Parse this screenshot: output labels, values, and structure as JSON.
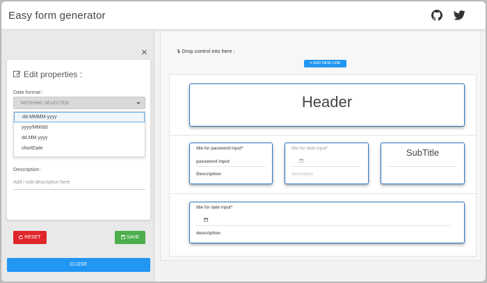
{
  "app": {
    "title": "Easy form generator"
  },
  "icons": {
    "github": "github-icon",
    "twitter": "twitter-icon",
    "edit": "edit-icon",
    "refresh": "refresh-icon",
    "save": "floppy-icon",
    "plus": "plus-icon",
    "calendar": "calendar-icon",
    "close": "close-icon",
    "drop": "arrow-down-icon"
  },
  "left": {
    "close_glyph": "×",
    "edit_properties": "Edit properties :",
    "date_format_label": "Date format :",
    "select_value": "NOTHING SELECTED",
    "options": [
      "dd-MMMM-yyyy",
      "yyyy/MM/dd",
      "dd.MM.yyyy",
      "shortDate"
    ],
    "description_label": "Description :",
    "description_placeholder": "Add / edit description here",
    "reset_label": "RESET",
    "save_label": "SAVE",
    "close_label": "CLOSE"
  },
  "canvas": {
    "drop_label": "Drop control into here :",
    "add_line_label": "ADD NEW LINE",
    "header": "Header",
    "subtitle": "SubTitle",
    "password": {
      "title": "title for password input*",
      "placeholder": "password input",
      "description": "Description"
    },
    "date1": {
      "title": "title for date input*",
      "description": "description"
    },
    "date2": {
      "title": "title for date input*",
      "description": "description"
    }
  },
  "colors": {
    "primary": "#2196f3",
    "danger": "#e0252b",
    "success": "#4cae4c",
    "control_border": "#2a74c9"
  }
}
